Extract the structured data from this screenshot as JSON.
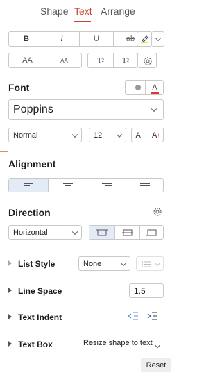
{
  "tabs": [
    {
      "label": "Shape",
      "active": false
    },
    {
      "label": "Text",
      "active": true
    },
    {
      "label": "Arrange",
      "active": false
    }
  ],
  "format_buttons": {
    "bold": "B",
    "italic": "I",
    "underline": "U",
    "strikethrough": "ab"
  },
  "case_buttons": {
    "uppercase": "AA",
    "smallcaps": "aa",
    "superscript": "T",
    "superscript_mark": "2",
    "subscript": "T",
    "subscript_mark": "2"
  },
  "font": {
    "title": "Font",
    "family": "Poppins",
    "style": "Normal",
    "size": "12",
    "decrease_label": "A",
    "increase_label": "A",
    "highlight_color": "#f2e33c",
    "text_color": "#e0392b"
  },
  "alignment": {
    "title": "Alignment"
  },
  "direction": {
    "title": "Direction",
    "value": "Horizontal"
  },
  "list_style": {
    "label": "List Style",
    "value": "None"
  },
  "line_space": {
    "label": "Line Space",
    "value": "1.5"
  },
  "text_indent": {
    "label": "Text Indent"
  },
  "text_box": {
    "label": "Text Box",
    "value": "Resize shape to text"
  },
  "reset_label": "Reset",
  "colors": {
    "accent": "#c8452f"
  }
}
